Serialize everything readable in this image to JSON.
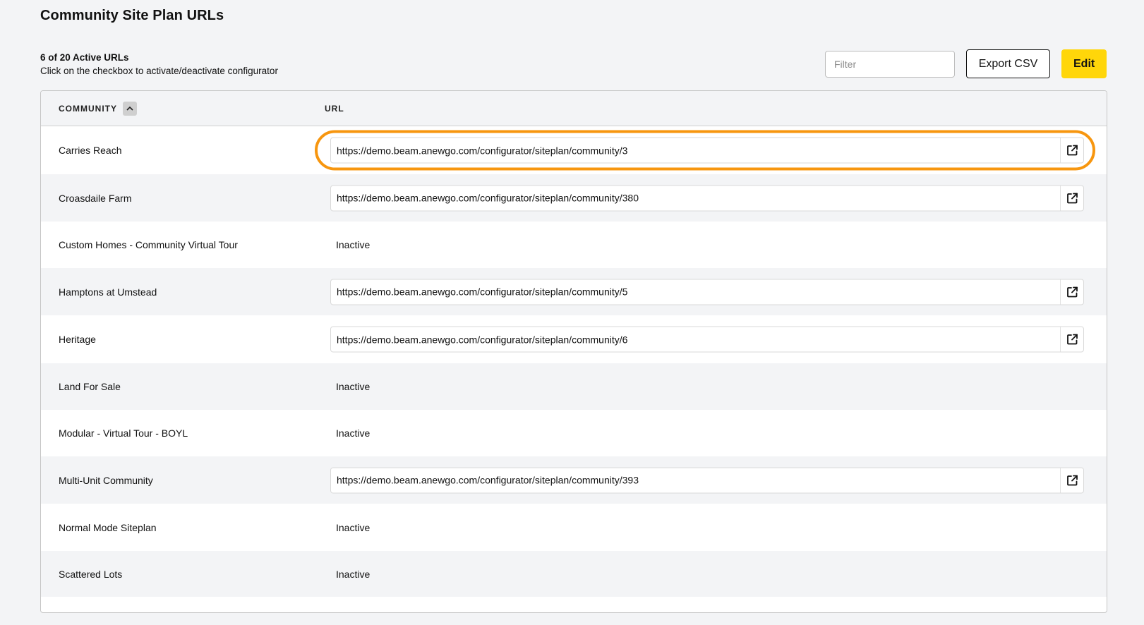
{
  "page": {
    "title": "Community Site Plan URLs"
  },
  "summary": {
    "count": "6 of 20 Active URLs",
    "hint": "Click on the checkbox to activate/deactivate configurator"
  },
  "toolbar": {
    "filter_placeholder": "Filter",
    "export_label": "Export CSV",
    "edit_label": "Edit"
  },
  "table": {
    "columns": {
      "community": "COMMUNITY",
      "url": "URL"
    },
    "rows": [
      {
        "community": "Carries Reach",
        "url": "https://demo.beam.anewgo.com/configurator/siteplan/community/3",
        "active": true
      },
      {
        "community": "Croasdaile Farm",
        "url": "https://demo.beam.anewgo.com/configurator/siteplan/community/380",
        "active": true
      },
      {
        "community": "Custom Homes - Community Virtual Tour",
        "url": "Inactive",
        "active": false
      },
      {
        "community": "Hamptons at Umstead",
        "url": "https://demo.beam.anewgo.com/configurator/siteplan/community/5",
        "active": true
      },
      {
        "community": "Heritage",
        "url": "https://demo.beam.anewgo.com/configurator/siteplan/community/6",
        "active": true
      },
      {
        "community": "Land For Sale",
        "url": "Inactive",
        "active": false
      },
      {
        "community": "Modular - Virtual Tour - BOYL",
        "url": "Inactive",
        "active": false
      },
      {
        "community": "Multi-Unit Community",
        "url": "https://demo.beam.anewgo.com/configurator/siteplan/community/393",
        "active": true
      },
      {
        "community": "Normal Mode Siteplan",
        "url": "Inactive",
        "active": false
      },
      {
        "community": "Scattered Lots",
        "url": "Inactive",
        "active": false
      }
    ]
  },
  "colors": {
    "accent_yellow": "#ffd60a",
    "highlight_orange": "#f7960f"
  }
}
